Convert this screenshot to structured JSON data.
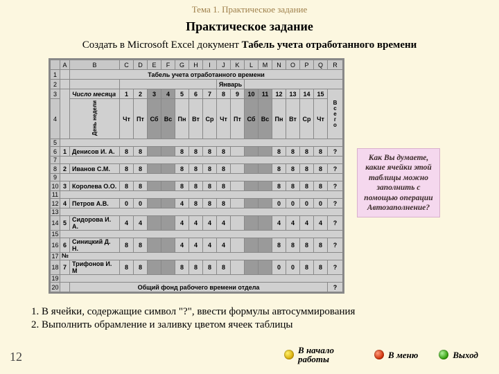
{
  "topic": "Тема 1. Практическое задание",
  "title": "Практическое задание",
  "subtitle_a": "Создать в Microsoft Excel документ ",
  "subtitle_b": "Табель учета отработанного времени",
  "excel": {
    "cols": [
      "A",
      "B",
      "C",
      "D",
      "E",
      "F",
      "G",
      "H",
      "I",
      "J",
      "K",
      "L",
      "M",
      "N",
      "O",
      "P",
      "Q",
      "R"
    ],
    "title": "Табель учета отработанного времени",
    "month": "Январь",
    "row_label_month": "Число месяца",
    "row_label_dow": "День недели",
    "numhdr": "№",
    "totalcol": "В\nс\nе\nг\nо",
    "days_num": [
      "1",
      "2",
      "3",
      "4",
      "5",
      "6",
      "7",
      "8",
      "9",
      "10",
      "11",
      "12",
      "13",
      "14",
      "15"
    ],
    "days_dow": [
      "Чт",
      "Пт",
      "Сб",
      "Вс",
      "Пн",
      "Вт",
      "Ср",
      "Чт",
      "Пт",
      "Сб",
      "Вс",
      "Пн",
      "Вт",
      "Ср",
      "Чт"
    ],
    "weekend_cols": [
      2,
      3,
      9,
      10
    ],
    "rows": [
      {
        "n": "1",
        "name": "Денисов И. А.",
        "v": [
          "8",
          "8",
          "",
          "",
          "8",
          "8",
          "8",
          "8",
          "",
          "",
          "",
          "8",
          "8",
          "8",
          "8"
        ],
        "t": "?"
      },
      {
        "n": "2",
        "name": "Иванов С.М.",
        "v": [
          "8",
          "8",
          "",
          "",
          "8",
          "8",
          "8",
          "8",
          "",
          "",
          "",
          "8",
          "8",
          "8",
          "8"
        ],
        "t": "?"
      },
      {
        "n": "3",
        "name": "Королева О.О.",
        "v": [
          "8",
          "8",
          "",
          "",
          "8",
          "8",
          "8",
          "8",
          "",
          "",
          "",
          "8",
          "8",
          "8",
          "8"
        ],
        "t": "?"
      },
      {
        "n": "4",
        "name": "Петров А.В.",
        "v": [
          "0",
          "0",
          "",
          "",
          "4",
          "8",
          "8",
          "8",
          "",
          "",
          "",
          "0",
          "0",
          "0",
          "0"
        ],
        "t": "?"
      },
      {
        "n": "5",
        "name": "Сидорова И. А.",
        "v": [
          "4",
          "4",
          "",
          "",
          "4",
          "4",
          "4",
          "4",
          "",
          "",
          "",
          "4",
          "4",
          "4",
          "4"
        ],
        "t": "?"
      },
      {
        "n": "6",
        "name": "Синицкий Д. Н.",
        "v": [
          "8",
          "8",
          "",
          "",
          "4",
          "4",
          "4",
          "4",
          "",
          "",
          "",
          "8",
          "8",
          "8",
          "8"
        ],
        "t": "?"
      },
      {
        "n": "7",
        "name": "Трифонов И. М",
        "v": [
          "8",
          "8",
          "",
          "",
          "8",
          "8",
          "8",
          "8",
          "",
          "",
          "",
          "0",
          "0",
          "8",
          "8"
        ],
        "t": "?"
      }
    ],
    "footer": "Общий фонд рабочего времени отдела",
    "footer_total": "?"
  },
  "callout": "Как Вы думаете, какие ячейки этой таблицы можно заполнить с помощью операции Автозаполнение?",
  "tasks": [
    "В ячейки, содержащие символ \"?\", ввести формулы автосуммирования",
    "Выполнить обрамление и заливку цветом ячеек таблицы"
  ],
  "nav": {
    "start": "В начало работы",
    "menu": "В меню",
    "exit": "Выход"
  },
  "page": "12"
}
